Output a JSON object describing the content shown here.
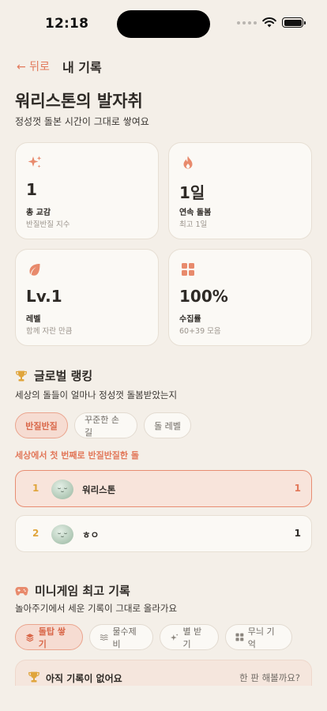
{
  "status_bar": {
    "time": "12:18"
  },
  "nav": {
    "back_label": "← 뒤로",
    "title": "내 기록"
  },
  "header": {
    "title": "워리스톤의 발자취",
    "subtitle": "정성껏 돌본 시간이 그대로 쌓여요"
  },
  "stats": [
    {
      "icon": "sparkle-icon",
      "value": "1",
      "label": "총 교감",
      "desc": "반질반질 지수"
    },
    {
      "icon": "flame-icon",
      "value": "1일",
      "label": "연속 돌봄",
      "desc": "최고 1일"
    },
    {
      "icon": "leaf-icon",
      "value": "Lv.1",
      "label": "레벨",
      "desc": "함께 자란 만큼"
    },
    {
      "icon": "grid-icon",
      "value": "100%",
      "label": "수집률",
      "desc": "60+39 모음"
    }
  ],
  "ranking": {
    "title": "글로벌 랭킹",
    "subtitle": "세상의 돌들이 얼마나 정성껏 돌봄받았는지",
    "tabs": [
      "반질반질",
      "꾸준한 손길",
      "돌 레벨"
    ],
    "active_tab": "반질반질",
    "caption": "세상에서 첫 번째로 반질반질한 돌",
    "rows": [
      {
        "rank": "1",
        "name": "워리스톤",
        "score": "1"
      },
      {
        "rank": "2",
        "name": "ㅎㅇ",
        "score": "1"
      }
    ]
  },
  "minigame": {
    "title": "미니게임 최고 기록",
    "subtitle": "놀아주기에서 세운 기록이 그대로 올라가요",
    "tabs": [
      {
        "label": "돌탑 쌓기",
        "icon": "layers-icon"
      },
      {
        "label": "물수제비",
        "icon": "waves-icon"
      },
      {
        "label": "별 받기",
        "icon": "star-sparkle-icon"
      },
      {
        "label": "무늬 기억",
        "icon": "grid-icon"
      }
    ],
    "active_tab": "돌탑 쌓기",
    "empty": {
      "title": "아직 기록이 없어요",
      "cta": "한 판 해볼까요?"
    }
  },
  "colors": {
    "accent": "#e2785a",
    "background": "#f4efe8",
    "gold": "#e0a53c"
  }
}
